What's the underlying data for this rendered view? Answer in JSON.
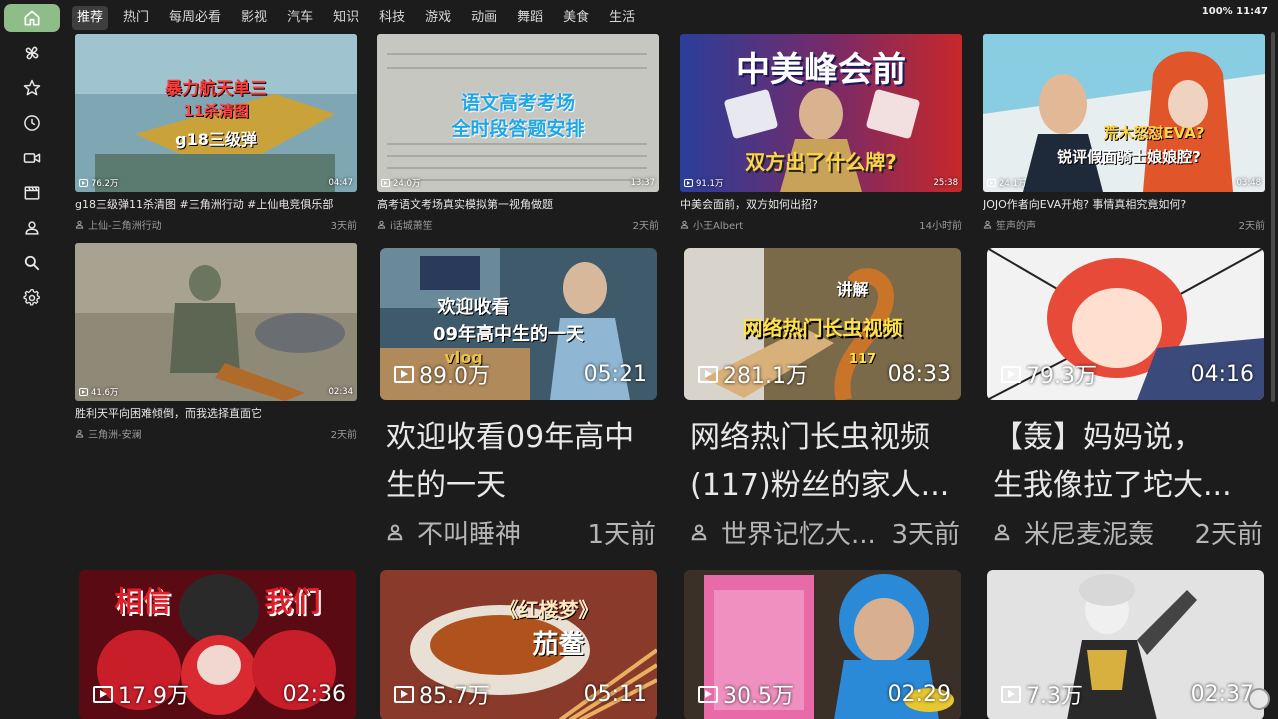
{
  "status": {
    "text": "100% 11:47"
  },
  "sidebar": {
    "items": [
      {
        "icon": "home-icon",
        "active": true
      },
      {
        "icon": "pinwheel-icon",
        "active": false
      },
      {
        "icon": "star-icon",
        "active": false
      },
      {
        "icon": "clock-icon",
        "active": false
      },
      {
        "icon": "video-camera-icon",
        "active": false
      },
      {
        "icon": "clapperboard-icon",
        "active": false
      },
      {
        "icon": "user-icon",
        "active": false
      },
      {
        "icon": "search-icon",
        "active": false
      },
      {
        "icon": "gear-icon",
        "active": false
      }
    ],
    "accent": "#8fbd8a"
  },
  "tabs": [
    "推荐",
    "热门",
    "每周必看",
    "影视",
    "汽车",
    "知识",
    "科技",
    "游戏",
    "动画",
    "舞蹈",
    "美食",
    "生活"
  ],
  "active_tab": "推荐",
  "videos_small": [
    {
      "views": "76.2万",
      "duration": "04:47",
      "title": "g18三级弹11杀清图 #三角洲行动 #上仙电竞俱乐部",
      "author": "上仙-三角洲行动",
      "time": "3天前",
      "overlay": [
        "暴力航天单三",
        "11杀清图",
        "g18三级弹"
      ]
    },
    {
      "views": "24.0万",
      "duration": "13:37",
      "title": "高考语文考场真实模拟第一视角做题",
      "author": "i话城萧笙",
      "time": "2天前",
      "overlay": [
        "语文高考考场",
        "全时段答题安排"
      ]
    },
    {
      "views": "91.1万",
      "duration": "25:38",
      "title": "中美会面前，双方如何出招?",
      "author": "小王Albert",
      "time": "14小时前",
      "overlay": [
        "中美峰会前",
        "双方出了什么牌?"
      ]
    },
    {
      "views": "24.1万",
      "duration": "03:48",
      "title": "JOJO作者向EVA开炮? 事情真相究竟如何?",
      "author": "笙声的声",
      "time": "2天前",
      "overlay": [
        "荒木怒怼EVA?",
        "锐评假面骑士娘娘腔?"
      ]
    },
    {
      "views": "41.6万",
      "duration": "02:34",
      "title": "胜利天平向困难倾倒，而我选择直面它",
      "author": "三角洲-安澜",
      "time": "2天前",
      "overlay": []
    }
  ],
  "videos_big": [
    {
      "views": "89.0万",
      "duration": "05:21",
      "title_lines": [
        "欢迎收看09年高中",
        "生的一天"
      ],
      "author": "不叫睡神",
      "time": "1天前",
      "overlay": [
        "欢迎收看",
        "09年高中生的一天",
        "vlog"
      ]
    },
    {
      "views": "281.1万",
      "duration": "08:33",
      "title_lines": [
        "网络热门长虫视频",
        "(117)粉丝的家人..."
      ],
      "author": "世界记忆大...",
      "time": "3天前",
      "overlay": [
        "讲解",
        "网络热门长虫视频",
        "117"
      ]
    },
    {
      "views": "79.3万",
      "duration": "04:16",
      "title_lines": [
        "【轰】妈妈说，",
        "生我像拉了坨大..."
      ],
      "author": "米尼麦泥轰",
      "time": "2天前",
      "overlay": []
    }
  ],
  "videos_row3": [
    {
      "views": "17.9万",
      "duration": "02:36",
      "overlay": [
        "相信",
        "我们"
      ]
    },
    {
      "views": "85.7万",
      "duration": "05:11",
      "overlay": [
        "《红楼梦》",
        "茄鲞"
      ]
    },
    {
      "views": "30.5万",
      "duration": "02:29",
      "overlay": []
    },
    {
      "views": "7.3万",
      "duration": "02:37",
      "overlay": []
    }
  ]
}
